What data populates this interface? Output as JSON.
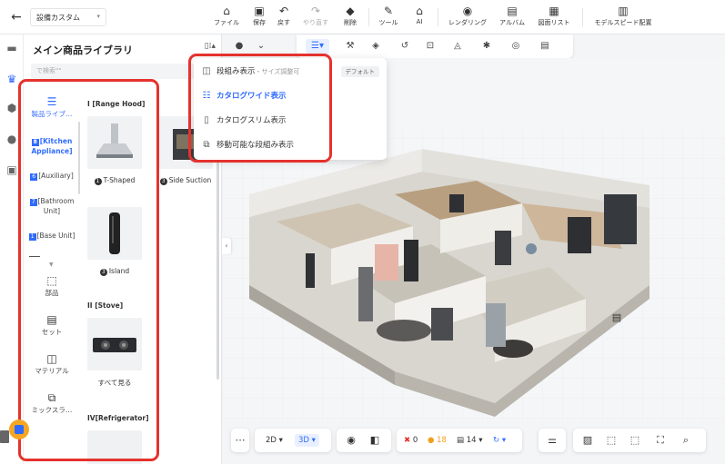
{
  "header": {
    "back_icon": "arrow-left-icon",
    "project_name": "設備カスタム",
    "items": [
      {
        "label": "ファイル",
        "icon": "home-icon"
      },
      {
        "label": "保存",
        "icon": "save-icon"
      },
      {
        "label": "戻す",
        "icon": "undo-icon"
      },
      {
        "label": "やり直す",
        "icon": "redo-icon"
      },
      {
        "label": "削除",
        "icon": "eraser-icon"
      },
      {
        "label": "ツール",
        "icon": "wrench-icon"
      },
      {
        "label": "AI",
        "icon": "ai-house-icon"
      },
      {
        "label": "レンダリング",
        "icon": "camera-icon"
      },
      {
        "label": "アルバム",
        "icon": "album-icon"
      },
      {
        "label": "図面リスト",
        "icon": "drawing-list-icon"
      },
      {
        "label": "モデルスピード配置",
        "icon": "speed-layout-icon"
      }
    ]
  },
  "library": {
    "title": "メイン商品ライブラリ",
    "view_icon": "view-mode-icon",
    "search_placeholder": "で検索\"\"",
    "categories": [
      {
        "label": "製品ライブ…",
        "icon": "product-library-icon"
      },
      {
        "tag": "8",
        "label": "[Kitchen Appliance]"
      },
      {
        "tag": "6",
        "label": "[Auxiliary]"
      },
      {
        "tag": "7",
        "label": "[Bathroom Unit]"
      },
      {
        "tag": "1",
        "label": "[Base Unit]"
      }
    ],
    "tools": [
      {
        "label": "部品",
        "icon": "parts-icon"
      },
      {
        "label": "セット",
        "icon": "set-icon"
      },
      {
        "label": "マテリアル",
        "icon": "material-icon"
      },
      {
        "label": "ミックスラ…",
        "icon": "mix-icon"
      }
    ],
    "sections": [
      {
        "title": "I [Range Hood]",
        "products": [
          {
            "num": "1",
            "label": "T-Shaped"
          },
          {
            "num": "3",
            "label": "Side Suction"
          },
          {
            "num": "3",
            "label": "Island"
          }
        ]
      },
      {
        "title": "II [Stove]",
        "products": [
          {
            "label": "すべて見る"
          }
        ]
      },
      {
        "title": "IV[Refrigerator]",
        "products": []
      }
    ]
  },
  "dropdown": {
    "items": [
      {
        "label": "段組み表示",
        "sub": "・サイズ調整可",
        "badge": "デフォルト",
        "icon": "columns-icon"
      },
      {
        "label": "カタログワイド表示",
        "icon": "catalog-wide-icon",
        "active": true
      },
      {
        "label": "カタログスリム表示",
        "icon": "catalog-slim-icon"
      },
      {
        "label": "移動可能な段組み表示",
        "icon": "movable-columns-icon"
      }
    ]
  },
  "bottom": {
    "view_2d": "2D",
    "view_3d": "3D",
    "error_count": "0",
    "warn_count": "18",
    "doc_count": "14"
  }
}
